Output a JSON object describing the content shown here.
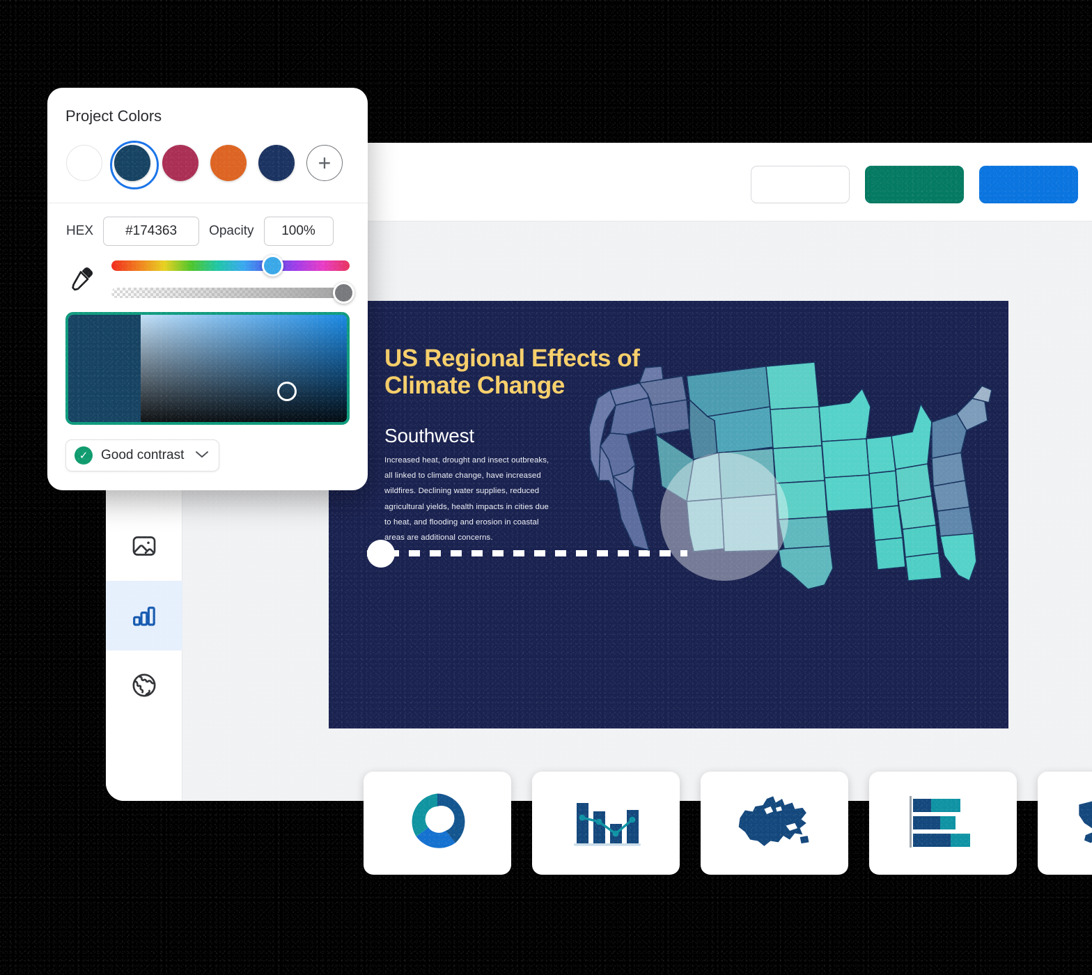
{
  "panel": {
    "title": "Project Colors",
    "swatches": [
      {
        "name": "swatch-white",
        "hex": "#ffffff",
        "selected": false,
        "empty": true
      },
      {
        "name": "swatch-teal-navy",
        "hex": "#174363",
        "selected": true,
        "empty": false
      },
      {
        "name": "swatch-magenta",
        "hex": "#ab2f55",
        "selected": false,
        "empty": false
      },
      {
        "name": "swatch-orange",
        "hex": "#dd6422",
        "selected": false,
        "empty": false
      },
      {
        "name": "swatch-navy",
        "hex": "#1b3361",
        "selected": false,
        "empty": false
      }
    ],
    "add_swatch_label": "+",
    "hex_label": "HEX",
    "hex_value": "#174363",
    "opacity_label": "Opacity",
    "opacity_value": "100%",
    "contrast_label": "Good contrast",
    "contrast_check_glyph": "✓",
    "contrast_chevron_glyph": "⌄",
    "accent_ring_color": "#1a73e8",
    "sv_border_color": "#0f9b7e",
    "contrast_badge_color": "#0f9b6e"
  },
  "app": {
    "header_buttons": [
      {
        "name": "header-button-ghost",
        "label": "",
        "color": "#ffffff"
      },
      {
        "name": "header-button-teal",
        "label": "",
        "color": "#057a62"
      },
      {
        "name": "header-button-blue",
        "label": "",
        "color": "#0a74df"
      }
    ],
    "rail_items": [
      {
        "name": "sidebar-item-briefcase",
        "icon": "briefcase-icon",
        "active": false
      },
      {
        "name": "sidebar-item-images",
        "icon": "image-icon",
        "active": false
      },
      {
        "name": "sidebar-item-charts",
        "icon": "bar-chart-icon",
        "active": true
      },
      {
        "name": "sidebar-item-maps",
        "icon": "globe-icon",
        "active": false
      }
    ],
    "active_rail_bg": "#e6effc",
    "active_rail_icon_color": "#1559b0"
  },
  "slide": {
    "title": "US Regional Effects of Climate Change",
    "subtitle": "Southwest",
    "body": "Increased heat, drought and insect outbreaks, all linked to climate change, have increased wildfires. Declining water supplies, reduced agricultural yields, health impacts in cities due to heat, and flooding and erosion in coastal areas are additional concerns.",
    "background_color": "#1a2250",
    "title_color": "#f7cf6a",
    "subtitle_color": "#ffffff",
    "highlighted_region": "Southwest",
    "highlighted_states": [
      "Nevada",
      "Utah",
      "Colorado",
      "Arizona",
      "New Mexico"
    ],
    "map_name": "us-states-map"
  },
  "thumbnails": [
    {
      "name": "thumbnail-donut-chart",
      "icon": "donut-chart-icon"
    },
    {
      "name": "thumbnail-bar-line-chart",
      "icon": "bar-line-chart-icon"
    },
    {
      "name": "thumbnail-canada-map",
      "icon": "canada-map-icon"
    },
    {
      "name": "thumbnail-stacked-bar-chart",
      "icon": "stacked-bar-chart-icon"
    },
    {
      "name": "thumbnail-us-map",
      "icon": "us-map-icon"
    }
  ]
}
